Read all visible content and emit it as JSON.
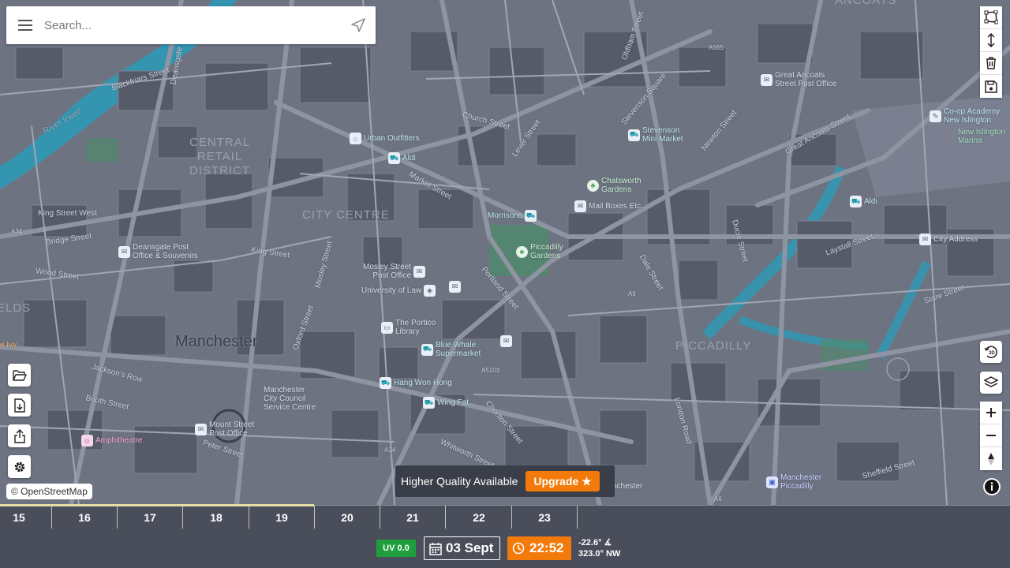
{
  "search": {
    "placeholder": "Search..."
  },
  "map": {
    "area_labels": {
      "central_retail": "CENTRAL\nRETAIL\nDISTRICT",
      "city_centre": "CITY CENTRE",
      "piccadilly": "PICCADILLY",
      "ancoats": "ANCOATS",
      "fields": "ELDS"
    },
    "city": "Manchester",
    "river": "River Irwell",
    "streets": {
      "s1": "Blackfriars Street",
      "s2": "Deansgate",
      "s3": "Church Street",
      "s4": "Market Street",
      "s5": "King Street West",
      "s6": "Bridge Street",
      "s7": "King Street",
      "s8": "Wood Street",
      "s9": "Jackson's Row",
      "s10": "Booth Street",
      "s11": "Peter Street",
      "s12": "Portland Street",
      "s13": "Mosley Street",
      "s14": "Lever Street",
      "s15": "Oldham Street",
      "s16": "Great Ancoats Street",
      "s17": "Laystall Street",
      "s18": "Store Street",
      "s19": "Sheffield Street",
      "s20": "London Road",
      "s21": "Whitworth Street",
      "s22": "Oxford Street",
      "s23": "Chorlton Street",
      "s24": "Newton Street",
      "s25": "Dale Street",
      "s26": "Ducie Street",
      "s27": "Stevenson Square",
      "road_a6": "A6",
      "road_a34": "A34",
      "road_a665": "A665",
      "road_a5103": "A5103",
      "road_a34_left": "A34",
      "road_a6_lower": "A6"
    },
    "pois": {
      "urban_outfitters": "Urban Outfitters",
      "aldi_1": "Aldi",
      "stevenson_market": "Stevenson\nMini Market",
      "great_ancoats_po": "Great Ancoats\nStreet Post Office",
      "coop_academy": "Co-op Academy\nNew Islington",
      "new_islington_marina": "New Islington\nMarina",
      "chatsworth_gardens": "Chatsworth\nGardens",
      "mail_boxes": "Mail Boxes Etc.",
      "morrisons": "Morrisons",
      "aldi_2": "Aldi",
      "city_address": "City Address",
      "piccadilly_gardens": "Piccadilly\nGardens",
      "deansgate_po": "Deansgate Post\nOffice & Souvenirs",
      "mosley_po": "Mosley Street\nPost Office",
      "university_of_law": "University of Law",
      "portico_library": "The Portico\nLibrary",
      "blue_whale": "Blue Whale\nSupermarket",
      "hang_won_hong": "Hang Won Hong",
      "wing_fat": "Wing Fat",
      "city_council": "Manchester\nCity Council\nService Centre",
      "mount_street_po": "Mount Street\nPost Office",
      "amphitheatre": "Amphitheatre",
      "manchester_piccadilly": "Manchester\nPiccadilly",
      "left_edge": "e Ivy",
      "partial_chester": "nchester"
    }
  },
  "attribution": "© OpenStreetMap",
  "upgrade": {
    "message": "Higher Quality Available",
    "button": "Upgrade ★"
  },
  "timeline": {
    "days": [
      "15",
      "16",
      "17",
      "18",
      "19",
      "20",
      "21",
      "22",
      "23"
    ],
    "progress_fraction": 0.311
  },
  "bottom": {
    "uv": "UV 0.0",
    "date": "03 Sept",
    "time": "22:52",
    "sun_elevation": "-22.6° ∡",
    "sun_azimuth": "323.0° NW"
  },
  "colors": {
    "accent": "#f27a0b",
    "uv_green": "#1f9e3d",
    "panel": "#4a4e5a",
    "water": "#2a9bb8",
    "park": "#4e8a6b"
  }
}
